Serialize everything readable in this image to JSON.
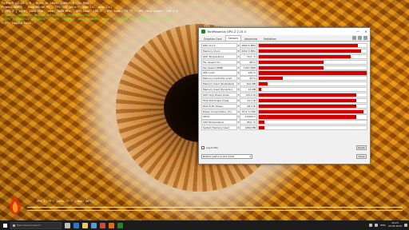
{
  "osd": {
    "lines": [
      {
        "text": "FurMark v1.25.1.0 - Burn-in test, 1280x720 (8X MSAA)",
        "color": "white"
      },
      {
        "text": "Frames:46895 - time:00:06:51 - FPS:113 (min:9, max:137, avg:114)",
        "color": "white"
      },
      {
        "text": "[ GPU-Z ] core: 1860 MHz - mem: 2000 MHz - GPU load: 100 % - GPU temp: 79 °C - GPU chip power: 220.4 W",
        "color": "white"
      },
      {
        "text": "> OpenGL renderer: NVIDIA GeForce GTX 1070/PCIe/SSE2",
        "color": "green"
      },
      {
        "text": "> GPU 1 (GeForce GTX 1070) - core: 1860MHz, mem: 2000MHz, temp: 79°C, GPU load: 100%, mem load: 22%",
        "color": "green"
      },
      {
        "text": "> F1: toggle help",
        "color": "white"
      }
    ],
    "bottom_label": "GPU 1: 79°C (min: 37°C - max: 80°C)"
  },
  "gpuz": {
    "title": "TechPowerUp GPU-Z 2.15.0",
    "controls": {
      "minimize": "—",
      "close": "✕"
    },
    "tabs": [
      {
        "label": "Graphics Card",
        "active": false
      },
      {
        "label": "Sensors",
        "active": true
      },
      {
        "label": "Advanced",
        "active": false
      },
      {
        "label": "Validation",
        "active": false
      }
    ],
    "sensors": [
      {
        "name": "GPU Clock",
        "value": "1860.5 MHz",
        "level": 0.92
      },
      {
        "name": "Memory Clock",
        "value": "2002.3 MHz",
        "level": 0.95
      },
      {
        "name": "GPU Temperature",
        "value": "79.0 °C",
        "level": 0.85
      },
      {
        "name": "Fan Speed (%)",
        "value": "58 %",
        "level": 0.6
      },
      {
        "name": "Fan Speed (RPM)",
        "value": "1912 RPM",
        "level": 0.6
      },
      {
        "name": "GPU Load",
        "value": "100 %",
        "level": 1.0
      },
      {
        "name": "Memory Controller Load",
        "value": "22 %",
        "level": 0.22
      },
      {
        "name": "Memory Used (Dedicated)",
        "value": "541 MB",
        "level": 0.08
      },
      {
        "name": "Memory Used (Dynamic)",
        "value": "14 MB",
        "level": 0.02
      },
      {
        "name": "GPU Chip Power Draw",
        "value": "125.0 W",
        "level": 0.9
      },
      {
        "name": "PCIe Slot Power Draw",
        "value": "22.1 W",
        "level": 0.9
      },
      {
        "name": "PCIe 8-Pin Power",
        "value": "98.3 W",
        "level": 0.9
      },
      {
        "name": "Power Consumption (%)",
        "value": "97.6 % TDP",
        "level": 0.97
      },
      {
        "name": "VDDC",
        "value": "1.0500 V",
        "level": 0.9
      },
      {
        "name": "CPU Temperature",
        "value": "48.0 °C",
        "level": 0.05
      },
      {
        "name": "System Memory Used",
        "value": "4462 MB",
        "level": 0.05
      }
    ],
    "log_to_file": "Log to file",
    "reset_label": "Reset",
    "device": "NVIDIA GeForce GTX 1070",
    "close_label": "Close"
  },
  "taskbar": {
    "search_placeholder": "Type here to search",
    "apps": [
      {
        "name": "task-view-icon",
        "color": "#bdbdbd"
      },
      {
        "name": "edge-icon",
        "color": "#3277bc"
      },
      {
        "name": "file-explorer-icon",
        "color": "#f2c94c"
      },
      {
        "name": "store-icon",
        "color": "#5b9bd5"
      },
      {
        "name": "chrome-icon",
        "color": "#db4437"
      },
      {
        "name": "furmark-icon",
        "color": "#e26b0a"
      },
      {
        "name": "gpuz-icon",
        "color": "#1a8a1a"
      }
    ],
    "language": "ENG",
    "time": "12:23",
    "date": "03.05.2019"
  },
  "colors": {
    "graph": "#d40000",
    "taskbar": "#1c1c1c"
  }
}
